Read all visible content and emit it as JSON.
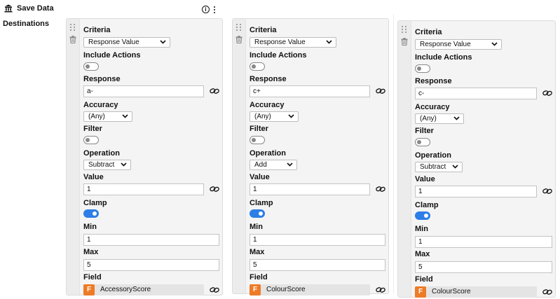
{
  "node": {
    "title": "Save Data",
    "destinations_label": "Destinations",
    "icon": "bank-icon"
  },
  "cards": [
    {
      "criteria_label": "Criteria",
      "criteria_value": "Response Value",
      "include_actions_label": "Include Actions",
      "include_actions_on": false,
      "response_label": "Response",
      "response_value": "a-",
      "accuracy_label": "Accuracy",
      "accuracy_value": "(Any)",
      "filter_label": "Filter",
      "filter_on": false,
      "operation_label": "Operation",
      "operation_value": "Subtract",
      "value_label": "Value",
      "value_value": "1",
      "clamp_label": "Clamp",
      "clamp_on": true,
      "min_label": "Min",
      "min_value": "1",
      "max_label": "Max",
      "max_value": "5",
      "field_label": "Field",
      "field_badge": "F",
      "field_value": "AccessoryScore"
    },
    {
      "criteria_label": "Criteria",
      "criteria_value": "Response Value",
      "include_actions_label": "Include Actions",
      "include_actions_on": false,
      "response_label": "Response",
      "response_value": "c+",
      "accuracy_label": "Accuracy",
      "accuracy_value": "(Any)",
      "filter_label": "Filter",
      "filter_on": false,
      "operation_label": "Operation",
      "operation_value": "Add",
      "value_label": "Value",
      "value_value": "1",
      "clamp_label": "Clamp",
      "clamp_on": true,
      "min_label": "Min",
      "min_value": "1",
      "max_label": "Max",
      "max_value": "5",
      "field_label": "Field",
      "field_badge": "F",
      "field_value": "ColourScore"
    },
    {
      "criteria_label": "Criteria",
      "criteria_value": "Response Value",
      "include_actions_label": "Include Actions",
      "include_actions_on": false,
      "response_label": "Response",
      "response_value": "c-",
      "accuracy_label": "Accuracy",
      "accuracy_value": "(Any)",
      "filter_label": "Filter",
      "filter_on": false,
      "operation_label": "Operation",
      "operation_value": "Subtract",
      "value_label": "Value",
      "value_value": "1",
      "clamp_label": "Clamp",
      "clamp_on": true,
      "min_label": "Min",
      "min_value": "1",
      "max_label": "Max",
      "max_value": "5",
      "field_label": "Field",
      "field_badge": "F",
      "field_value": "ColourScore"
    }
  ]
}
